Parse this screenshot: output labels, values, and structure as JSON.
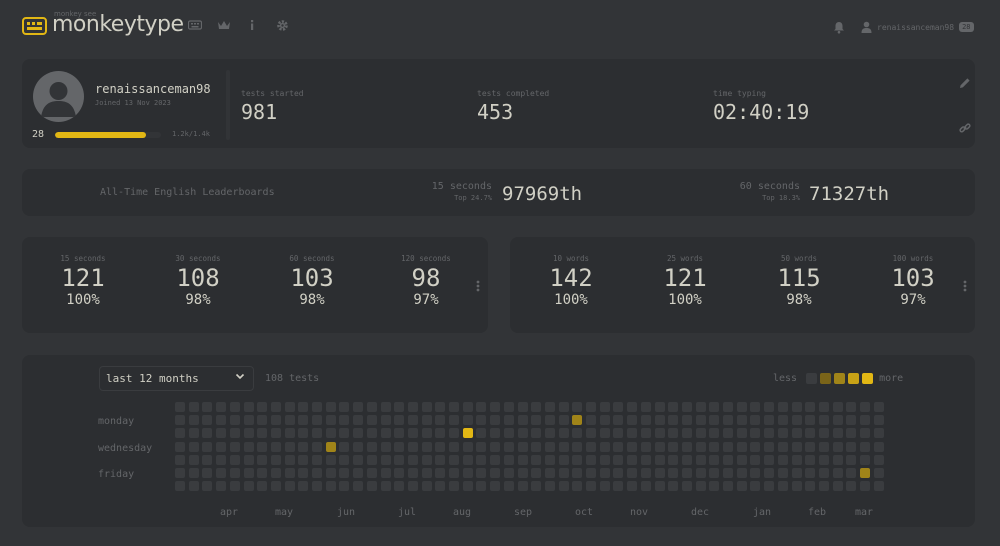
{
  "header": {
    "logo_small": "monkey see",
    "logo_text": "monkeytype",
    "nav_icons": [
      "keyboard-icon",
      "crown-icon",
      "info-icon",
      "gear-icon"
    ],
    "account_name": "renaissanceman98",
    "account_level": "28"
  },
  "profile": {
    "username": "renaissanceman98",
    "joined": "Joined 13 Nov 2023",
    "level": "28",
    "xp_text": "1.2k/1.4k",
    "xp_fraction": 0.857,
    "stats": [
      {
        "label": "tests started",
        "value": "981"
      },
      {
        "label": "tests completed",
        "value": "453"
      },
      {
        "label": "time typing",
        "value": "02:40:19"
      }
    ]
  },
  "leaderboards": {
    "title": "All-Time English Leaderboards",
    "entries": [
      {
        "mode": "15 seconds",
        "top": "Top 24.7%",
        "rank": "97969th"
      },
      {
        "mode": "60 seconds",
        "top": "Top 18.3%",
        "rank": "71327th"
      }
    ]
  },
  "pbs_time": [
    {
      "mode": "15 seconds",
      "wpm": "121",
      "acc": "100%"
    },
    {
      "mode": "30 seconds",
      "wpm": "108",
      "acc": "98%"
    },
    {
      "mode": "60 seconds",
      "wpm": "103",
      "acc": "98%"
    },
    {
      "mode": "120 seconds",
      "wpm": "98",
      "acc": "97%"
    }
  ],
  "pbs_words": [
    {
      "mode": "10 words",
      "wpm": "142",
      "acc": "100%"
    },
    {
      "mode": "25 words",
      "wpm": "121",
      "acc": "100%"
    },
    {
      "mode": "50 words",
      "wpm": "115",
      "acc": "98%"
    },
    {
      "mode": "100 words",
      "wpm": "103",
      "acc": "97%"
    }
  ],
  "activity": {
    "range": "last 12 months",
    "tests": "108 tests",
    "legend_less": "less",
    "legend_more": "more",
    "legend_colors": [
      "#3a3c3f",
      "#7a6419",
      "#a08419",
      "#c8a216",
      "#e2b714"
    ],
    "day_labels": [
      "monday",
      "wednesday",
      "friday"
    ],
    "months": [
      "apr",
      "may",
      "jun",
      "jul",
      "aug",
      "sep",
      "oct",
      "nov",
      "dec",
      "jan",
      "feb",
      "mar"
    ],
    "active_cells": [
      {
        "week": 11,
        "day": 3,
        "level": 2
      },
      {
        "week": 21,
        "day": 2,
        "level": 4
      },
      {
        "week": 29,
        "day": 1,
        "level": 2
      },
      {
        "week": 50,
        "day": 5,
        "level": 2
      }
    ]
  },
  "colors": {
    "bg": "#323437",
    "card": "#2c2e31",
    "accent": "#e2b714",
    "sub": "#646669",
    "text": "#d1d0c5"
  }
}
